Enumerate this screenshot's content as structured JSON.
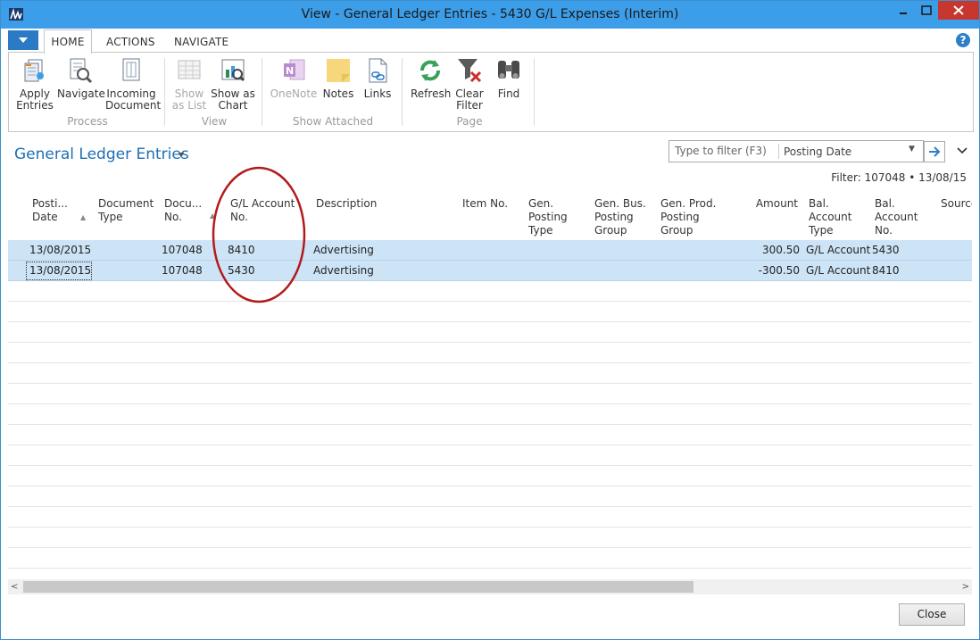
{
  "window": {
    "title": "View - General Ledger Entries - 5430 G/L Expenses (Interim)"
  },
  "ribbon_tabs": [
    "HOME",
    "ACTIONS",
    "NAVIGATE"
  ],
  "ribbon": {
    "groups": [
      {
        "label": "Process",
        "buttons": [
          "Apply Entries",
          "Navigate",
          "Incoming Document"
        ]
      },
      {
        "label": "View",
        "buttons": [
          "Show as List",
          "Show as Chart"
        ]
      },
      {
        "label": "Show Attached",
        "buttons": [
          "OneNote",
          "Notes",
          "Links"
        ]
      },
      {
        "label": "Page",
        "buttons": [
          "Refresh",
          "Clear Filter",
          "Find"
        ]
      }
    ],
    "apply_entries": [
      "Apply",
      "Entries"
    ],
    "navigate": "Navigate",
    "incoming_document": [
      "Incoming",
      "Document"
    ],
    "show_as_list": [
      "Show",
      "as List"
    ],
    "show_as_chart": [
      "Show as",
      "Chart"
    ],
    "onenote": "OneNote",
    "notes": "Notes",
    "links": "Links",
    "refresh": "Refresh",
    "clear_filter": [
      "Clear",
      "Filter"
    ],
    "find": "Find",
    "group_process": "Process",
    "group_view": "View",
    "group_show_attached": "Show Attached",
    "group_page": "Page"
  },
  "page": {
    "title": "General Ledger Entries",
    "filter_placeholder": "Type to filter (F3)",
    "filter_field": "Posting Date",
    "filter_summary": "Filter: 107048 • 13/08/15"
  },
  "grid": {
    "columns": [
      [
        "Posti...",
        "Date"
      ],
      [
        "Document",
        "Type"
      ],
      [
        "Docu...",
        "No."
      ],
      [
        "G/L Account",
        "No."
      ],
      [
        "Description"
      ],
      [
        "Item No."
      ],
      [
        "Gen.",
        "Posting",
        "Type"
      ],
      [
        "Gen. Bus.",
        "Posting",
        "Group"
      ],
      [
        "Gen. Prod.",
        "Posting",
        "Group"
      ],
      [
        "Amount"
      ],
      [
        "Bal.",
        "Account",
        "Type"
      ],
      [
        "Bal.",
        "Account",
        "No."
      ],
      [
        "Source"
      ]
    ],
    "rows": [
      {
        "posting_date": "13/08/2015",
        "document_no": "107048",
        "gl_account_no": "8410",
        "description": "Advertising",
        "amount": "300.50",
        "bal_account_type": "G/L Account",
        "bal_account_no": "5430"
      },
      {
        "posting_date": "13/08/2015",
        "document_no": "107048",
        "gl_account_no": "5430",
        "description": "Advertising",
        "amount": "-300.50",
        "bal_account_type": "G/L Account",
        "bal_account_no": "8410"
      }
    ]
  },
  "footer": {
    "close": "Close"
  },
  "colors": {
    "title_bar": "#3c9de8",
    "accent_blue": "#1e6fb5",
    "selected_row": "#cde4f7",
    "annotation_red": "#b31b1b"
  }
}
